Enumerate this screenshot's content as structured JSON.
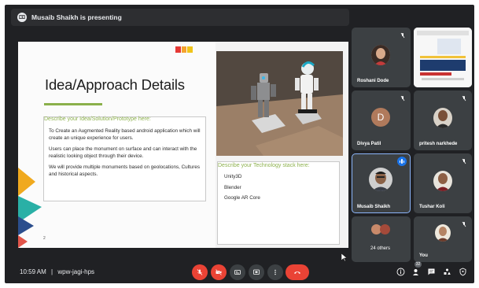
{
  "presenting_bar": {
    "text": "Musaib Shaikh is presenting"
  },
  "slide": {
    "title": "Idea/Approach Details",
    "idea_heading": "Describe your Idea/Solution/Prototype here:",
    "idea_paragraphs": [
      "To Create an Augmented Reality based android application which will create an unique experience for users.",
      "Users can place the monument on surface and can interact with the realistic looking object through their device.",
      "We will provide multiple monuments based on geolocations, Cultures and historical aspects."
    ],
    "tech_heading": "Describe your Technology stack here:",
    "tech_items": [
      "Unity3D",
      "Blender",
      "Google AR Core"
    ],
    "page_number": "2",
    "accent_color": "#8ab04a"
  },
  "participants": [
    {
      "name": "Roshani Dode",
      "muted": true
    },
    {
      "name": "",
      "muted": true,
      "screen_share": true
    },
    {
      "name": "Divya Patil",
      "muted": true,
      "initial": "D"
    },
    {
      "name": "pritesh narkhede",
      "muted": true
    },
    {
      "name": "Musaib Shaikh",
      "speaking": true
    },
    {
      "name": "Tushar Koli",
      "muted": true
    },
    {
      "name": "24 others"
    },
    {
      "name": "You",
      "muted": true
    }
  ],
  "bottom_bar": {
    "time": "10:59 AM",
    "separator": "|",
    "meeting_code": "wpw-jagi-hps",
    "participant_count": "32",
    "controls": [
      "mic-off",
      "camera-off",
      "captions",
      "present",
      "more",
      "leave-call"
    ],
    "right_icons": [
      "info",
      "people",
      "chat",
      "activities",
      "host-controls"
    ]
  },
  "colors": {
    "background": "#202124",
    "tile": "#3c4043",
    "danger": "#ea4335",
    "active_outline": "#8ab4f8"
  }
}
